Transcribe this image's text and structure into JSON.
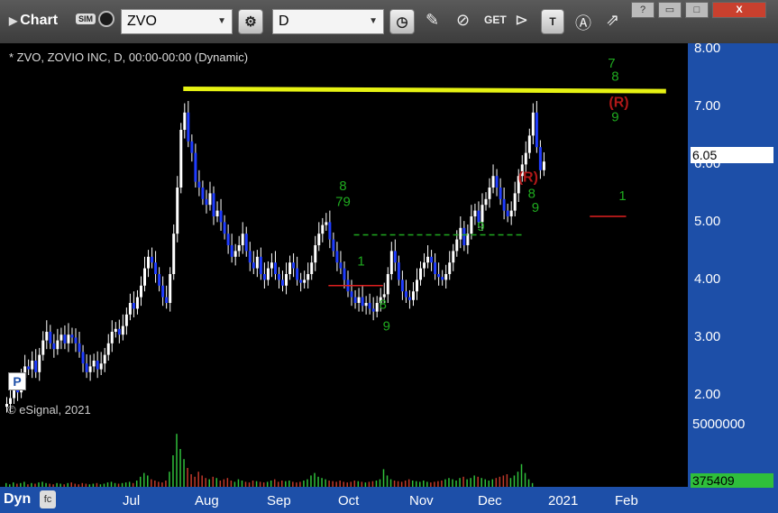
{
  "toolbar": {
    "title": "Chart",
    "sim_badge": "SIM",
    "symbol": "ZVO",
    "interval": "D"
  },
  "window_buttons": [
    "?",
    "▭",
    "□",
    "X"
  ],
  "chart": {
    "symbol_label": "* ZVO, ZOVIO INC, D, 00:00-00:00 (Dynamic)",
    "copyright": "© eSignal, 2021",
    "last_price": "6.05",
    "last_volume": "375409",
    "volume_scale_label": "5000000",
    "bottom_mode": "Dyn"
  },
  "chart_data": {
    "type": "candlestick",
    "price_axis": {
      "ticks": [
        "8.00",
        "7.00",
        "6.00",
        "5.00",
        "4.00",
        "3.00",
        "2.00"
      ],
      "ylim": [
        1.6,
        8.1
      ]
    },
    "x_axis": {
      "ticks": [
        "Jul",
        "Aug",
        "Sep",
        "Oct",
        "Nov",
        "Dec",
        "2021",
        "Feb"
      ]
    },
    "colors": {
      "up": "#ffffff",
      "down": "#1f3cff",
      "resistance": "#e6f213",
      "td_count": "#1faa1f",
      "td_perfect": "#b01818",
      "dashed_level": "#1faa1f",
      "risk_level": "#e02020"
    },
    "closes": [
      1.85,
      1.95,
      2.1,
      2.05,
      2.3,
      2.5,
      2.45,
      2.6,
      2.4,
      2.7,
      2.95,
      3.1,
      2.9,
      2.8,
      2.95,
      3.05,
      2.9,
      3.05,
      3.0,
      2.9,
      2.75,
      2.55,
      2.4,
      2.5,
      2.6,
      2.45,
      2.55,
      2.7,
      2.9,
      3.1,
      3.15,
      3.05,
      3.2,
      3.4,
      3.6,
      3.5,
      3.7,
      3.9,
      4.2,
      4.4,
      4.3,
      4.1,
      3.9,
      3.7,
      3.6,
      4.1,
      4.8,
      5.6,
      6.6,
      6.9,
      6.4,
      6.2,
      5.7,
      5.6,
      5.4,
      5.3,
      5.5,
      5.1,
      5.2,
      5.0,
      4.8,
      4.6,
      4.4,
      4.5,
      4.6,
      4.8,
      4.5,
      4.3,
      4.2,
      4.4,
      4.1,
      4.0,
      4.2,
      4.3,
      4.1,
      4.0,
      3.9,
      4.1,
      4.3,
      4.2,
      4.0,
      3.95,
      4.0,
      4.1,
      4.3,
      4.6,
      4.8,
      4.95,
      5.0,
      4.7,
      4.5,
      4.3,
      4.2,
      4.0,
      3.8,
      3.7,
      3.6,
      3.7,
      3.55,
      3.6,
      3.5,
      3.45,
      3.6,
      3.7,
      3.75,
      4.1,
      4.5,
      4.3,
      4.0,
      3.8,
      3.7,
      3.65,
      3.8,
      4.0,
      4.2,
      4.3,
      4.4,
      4.3,
      4.1,
      4.05,
      4.0,
      4.1,
      4.3,
      4.5,
      4.7,
      4.9,
      4.6,
      4.8,
      5.1,
      5.2,
      5.0,
      5.3,
      5.4,
      5.6,
      5.8,
      5.6,
      5.4,
      5.2,
      5.1,
      5.2,
      5.5,
      5.8,
      6.0,
      6.2,
      6.5,
      6.9,
      6.3,
      5.9,
      6.05
    ],
    "volumes": [
      0.3,
      0.2,
      0.35,
      0.25,
      0.3,
      0.4,
      0.2,
      0.3,
      0.25,
      0.35,
      0.4,
      0.3,
      0.25,
      0.2,
      0.3,
      0.25,
      0.2,
      0.3,
      0.35,
      0.25,
      0.2,
      0.3,
      0.25,
      0.2,
      0.25,
      0.3,
      0.2,
      0.25,
      0.35,
      0.4,
      0.3,
      0.25,
      0.3,
      0.35,
      0.4,
      0.3,
      0.5,
      0.8,
      1.1,
      0.9,
      0.6,
      0.5,
      0.4,
      0.35,
      0.5,
      1.2,
      2.5,
      4.2,
      3.0,
      2.2,
      1.5,
      1.0,
      0.8,
      1.2,
      0.9,
      0.7,
      0.6,
      0.8,
      0.7,
      0.5,
      0.6,
      0.7,
      0.5,
      0.4,
      0.6,
      0.5,
      0.4,
      0.35,
      0.5,
      0.45,
      0.4,
      0.35,
      0.4,
      0.5,
      0.6,
      0.4,
      0.5,
      0.45,
      0.5,
      0.4,
      0.35,
      0.4,
      0.5,
      0.6,
      0.9,
      1.1,
      0.8,
      0.7,
      0.6,
      0.5,
      0.45,
      0.4,
      0.5,
      0.4,
      0.35,
      0.4,
      0.5,
      0.45,
      0.4,
      0.35,
      0.4,
      0.45,
      0.5,
      0.6,
      1.4,
      0.9,
      0.6,
      0.5,
      0.45,
      0.4,
      0.5,
      0.6,
      0.5,
      0.45,
      0.4,
      0.5,
      0.4,
      0.35,
      0.4,
      0.45,
      0.5,
      0.6,
      0.7,
      0.6,
      0.5,
      0.7,
      0.8,
      0.6,
      0.7,
      0.9,
      0.8,
      0.7,
      0.6,
      0.5,
      0.6,
      0.7,
      0.8,
      0.9,
      1.0,
      0.7,
      0.9,
      1.2,
      1.8,
      1.1,
      0.6,
      0.3
    ],
    "td_labels": [
      {
        "t": "8",
        "x": 93,
        "y": 5.55,
        "c": "td_count"
      },
      {
        "t": "79",
        "x": 93,
        "y": 5.28,
        "c": "td_count"
      },
      {
        "t": "1",
        "x": 98,
        "y": 4.25,
        "c": "td_count"
      },
      {
        "t": "9",
        "x": 105,
        "y": 3.12,
        "c": "td_count"
      },
      {
        "t": "8",
        "x": 104,
        "y": 3.5,
        "c": "td_count"
      },
      {
        "t": "9",
        "x": 131,
        "y": 4.85,
        "c": "td_count"
      },
      {
        "t": "(R)",
        "x": 144,
        "y": 5.7,
        "c": "td_perfect"
      },
      {
        "t": "8",
        "x": 145,
        "y": 5.42,
        "c": "td_count"
      },
      {
        "t": "9",
        "x": 146,
        "y": 5.18,
        "c": "td_count"
      },
      {
        "t": "7",
        "x": 167,
        "y": 7.68,
        "c": "td_count"
      },
      {
        "t": "8",
        "x": 168,
        "y": 7.45,
        "c": "td_count"
      },
      {
        "t": "(R)",
        "x": 169,
        "y": 7.0,
        "c": "td_perfect"
      },
      {
        "t": "9",
        "x": 168,
        "y": 6.75,
        "c": "td_count"
      },
      {
        "t": "1",
        "x": 170,
        "y": 5.38,
        "c": "td_count"
      }
    ],
    "levels": [
      {
        "type": "resistance",
        "x1": 49,
        "x2": 182,
        "y1": 7.31,
        "y2": 7.27
      },
      {
        "type": "dashed_level",
        "x1": 96,
        "x2": 143,
        "y1": 4.78,
        "y2": 4.78
      },
      {
        "type": "risk_level",
        "x1": 89,
        "x2": 104,
        "y1": 3.9,
        "y2": 3.9
      },
      {
        "type": "risk_level",
        "x1": 161,
        "x2": 171,
        "y1": 5.1,
        "y2": 5.1
      }
    ]
  }
}
